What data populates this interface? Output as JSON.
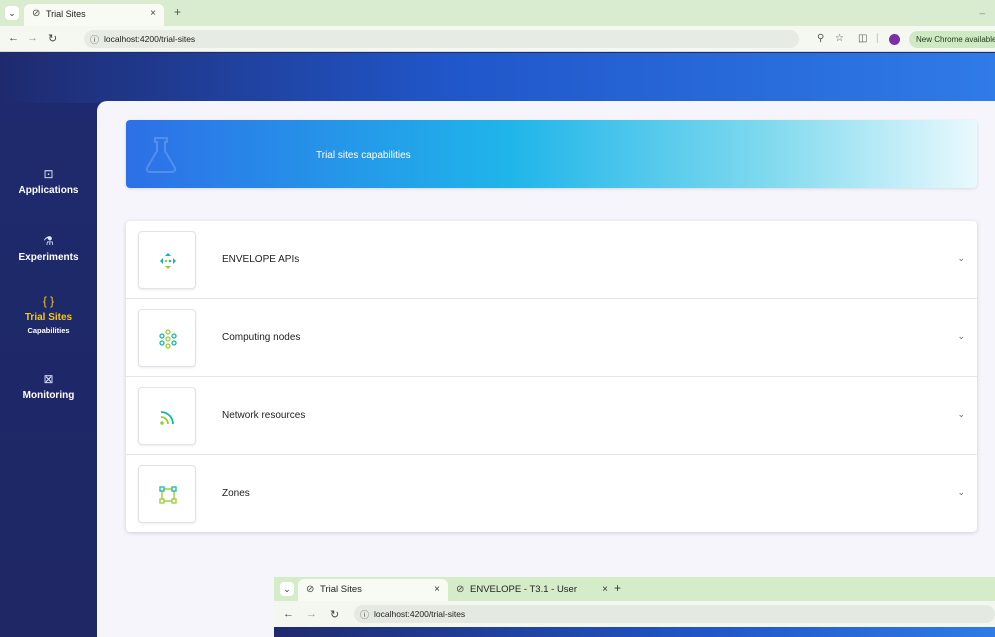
{
  "browser": {
    "tab_title": "Trial Sites",
    "url": "localhost:4200/trial-sites",
    "update_label": "New Chrome available"
  },
  "sidebar": {
    "items": [
      {
        "label": "Applications",
        "icon": "code-window-icon"
      },
      {
        "label": "Experiments",
        "icon": "flask-icon"
      },
      {
        "label": "Trial Sites",
        "sublabel": "Capabilities",
        "icon": "braces-icon",
        "active": true
      },
      {
        "label": "Monitoring",
        "icon": "monitor-chart-icon"
      }
    ]
  },
  "banner": {
    "title": "Trial sites capabilities"
  },
  "capabilities": [
    {
      "label": "ENVELOPE APIs",
      "icon": "api-arrows-icon"
    },
    {
      "label": "Computing nodes",
      "icon": "nodes-network-icon"
    },
    {
      "label": "Network resources",
      "icon": "signal-feed-icon"
    },
    {
      "label": "Zones",
      "icon": "zone-square-icon"
    }
  ],
  "second_window": {
    "tab1_title": "Trial Sites",
    "tab2_title": "ENVELOPE - T3.1 - User",
    "url": "localhost:4200/trial-sites"
  },
  "colors": {
    "sidebar": "#1e2a6d",
    "active": "#f5c518",
    "accent_green": "#9acd32",
    "accent_teal": "#14b8a6"
  }
}
